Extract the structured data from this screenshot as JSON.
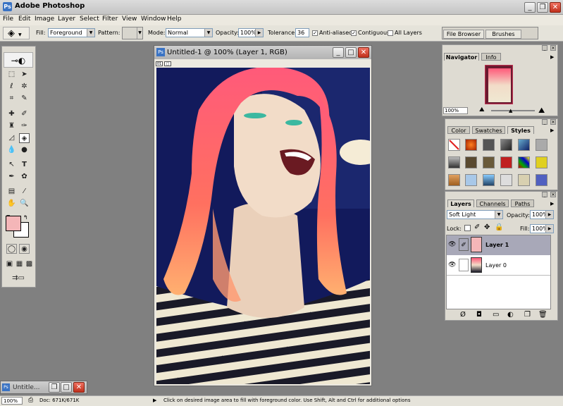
{
  "app_title": "Adobe Photoshop",
  "menu": [
    "File",
    "Edit",
    "Image",
    "Layer",
    "Select",
    "Filter",
    "View",
    "Window",
    "Help"
  ],
  "options": {
    "fill_label": "Fill:",
    "fill_value": "Foreground",
    "pattern_label": "Pattern:",
    "mode_label": "Mode:",
    "mode_value": "Normal",
    "opacity_label": "Opacity:",
    "opacity_value": "100%",
    "tolerance_label": "Tolerance:",
    "tolerance_value": "36",
    "anti_aliased": "Anti-aliased",
    "contiguous": "Contiguous",
    "all_layers": "All Layers",
    "file_browser": "File Browser",
    "brushes": "Brushes"
  },
  "document": {
    "title": "Untitled-1 @ 100% (Layer 1, RGB)",
    "badges": [
      "01",
      "□"
    ]
  },
  "navigator": {
    "tabs": [
      "Navigator",
      "Info"
    ],
    "zoom": "100%"
  },
  "styles_panel": {
    "tabs": [
      "Color",
      "Swatches",
      "Styles"
    ]
  },
  "layers_panel": {
    "tabs": [
      "Layers",
      "Channels",
      "Paths"
    ],
    "blend_mode": "Soft Light",
    "opacity_label": "Opacity:",
    "opacity_value": "100%",
    "lock_label": "Lock:",
    "fill_label": "Fill:",
    "fill_value": "100%",
    "layers": [
      "Layer 1",
      "Layer 0"
    ]
  },
  "minimized_window": "Untitle...",
  "status": {
    "zoom": "100%",
    "doc": "Doc: 671K/671K",
    "hint": "Click on desired image area to fill with foreground color.  Use Shift, Alt and Ctrl for additional options"
  },
  "colors": {
    "foreground": "#f4b6b8",
    "background": "#ffffff",
    "active_layer_fill": "#f4b6b8"
  }
}
